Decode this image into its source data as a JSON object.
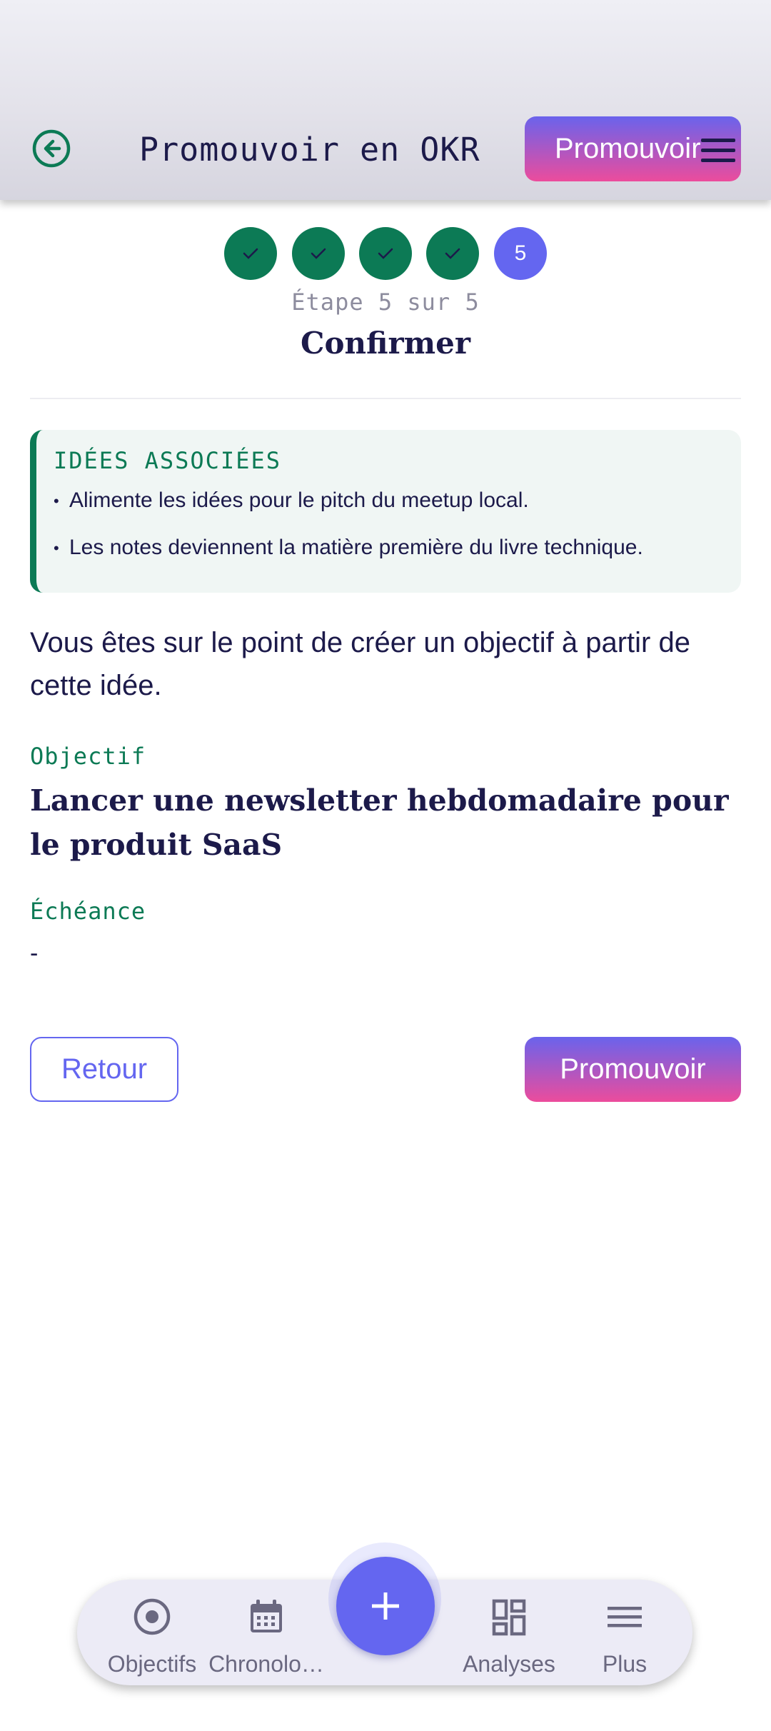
{
  "appbar": {
    "title": "Promouvoir en OKR",
    "promote_label": "Promouvoir",
    "back_icon": "arrow-back-circle-icon",
    "menu_icon": "hamburger-menu-icon"
  },
  "stepper": {
    "steps": [
      {
        "state": "done",
        "icon": "check-icon"
      },
      {
        "state": "done",
        "icon": "check-icon"
      },
      {
        "state": "done",
        "icon": "check-icon"
      },
      {
        "state": "done",
        "icon": "check-icon"
      },
      {
        "state": "current",
        "label": "5"
      }
    ],
    "caption": "Étape 5 sur 5",
    "title": "Confirmer"
  },
  "ideas": {
    "title": "IDÉES ASSOCIÉES",
    "items": [
      "Alimente les idées pour le pitch du meetup local.",
      "Les notes deviennent la matière première du livre technique."
    ]
  },
  "intro": "Vous êtes sur le point de créer un objectif à partir de cette idée.",
  "objective": {
    "label": "Objectif",
    "value": "Lancer une newsletter hebdomadaire pour le produit SaaS"
  },
  "deadline": {
    "label": "Échéance",
    "value": "-"
  },
  "actions": {
    "back_label": "Retour",
    "promote_label": "Promouvoir"
  },
  "bottom_nav": {
    "items": [
      {
        "label": "Objectifs",
        "icon": "target-icon"
      },
      {
        "label": "Chronolo…",
        "icon": "calendar-icon"
      },
      {
        "label": "Analyses",
        "icon": "dashboard-icon"
      },
      {
        "label": "Plus",
        "icon": "menu-lines-icon"
      }
    ],
    "fab_icon": "plus-icon"
  },
  "colors": {
    "primary": "#6466f0",
    "success": "#0c7a55",
    "text": "#1c1a4a",
    "gradient_start": "#6a63ec",
    "gradient_end": "#ec4c9c"
  }
}
